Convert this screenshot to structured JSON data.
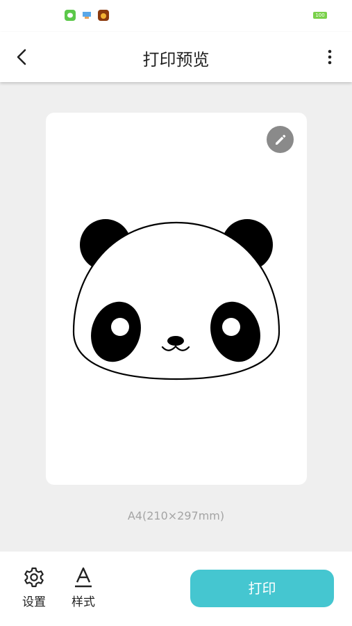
{
  "status_bar": {
    "icons": [
      "wechat-app-icon",
      "notification-app-icon",
      "game-app-icon"
    ],
    "battery": "100"
  },
  "header": {
    "title": "打印预览",
    "back_icon": "chevron-left-icon",
    "more_icon": "more-vertical-icon"
  },
  "preview": {
    "edit_icon": "pencil-icon",
    "image": "panda-face",
    "paper_size": "A4(210×297mm)"
  },
  "bottom_bar": {
    "settings_label": "设置",
    "style_label": "样式",
    "print_label": "打印"
  },
  "colors": {
    "accent": "#45c6d0",
    "background": "#efefef",
    "edit_button": "#8a8a8a"
  }
}
